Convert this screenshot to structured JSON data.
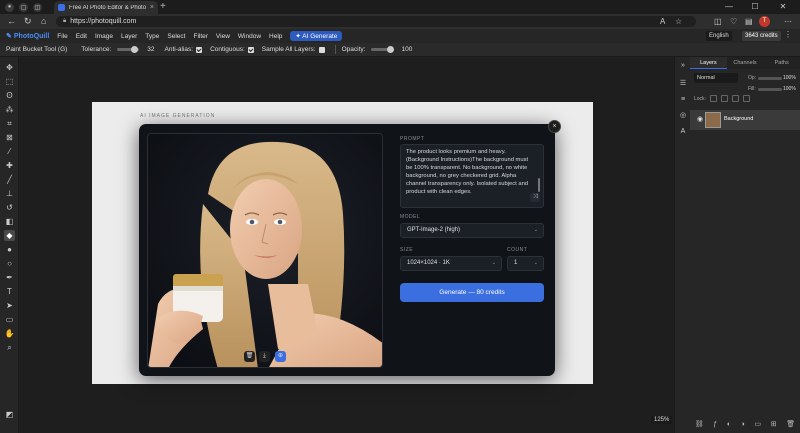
{
  "browser": {
    "tab_title": "Free AI Photo Editor & Photosho",
    "url": "https://photoquill.com",
    "new_tab": "+",
    "minimize": "—",
    "maximize": "☐",
    "close": "✕"
  },
  "menubar": {
    "logo": "PhotoQuill",
    "items": [
      "File",
      "Edit",
      "Image",
      "Layer",
      "Type",
      "Select",
      "Filter",
      "View",
      "Window",
      "Help"
    ],
    "ai_generate": "✦ AI Generate",
    "language": "English",
    "credits": "3643 credits"
  },
  "options": {
    "tool_name": "Paint Bucket Tool (G)",
    "tolerance_label": "Tolerance:",
    "tolerance_value": "32",
    "antialias_label": "Anti-alias:",
    "contiguous_label": "Contiguous:",
    "sample_all_label": "Sample All Layers:",
    "opacity_label": "Opacity:",
    "opacity_value": "100"
  },
  "canvas": {
    "doc_label": "AI IMAGE GENERATION",
    "zoom": "125%"
  },
  "modal": {
    "prompt_label": "PROMPT",
    "prompt_text": "The product looks premium and heavy. (Background Instructions)The background must be 100% transparent. No background, no white background, no grey checkered grid. Alpha channel transparency only. Isolated subject and product with clean edges.",
    "model_label": "MODEL",
    "model_value": "GPT-Image-2 (high)",
    "size_label": "SIZE",
    "size_value": "1024×1024 · 1K",
    "count_label": "COUNT",
    "count_value": "1",
    "generate_label": "Generate — 80 credits",
    "close": "×"
  },
  "layers_panel": {
    "tabs": [
      "Layers",
      "Channels",
      "Paths"
    ],
    "blend_mode": "Normal",
    "opacity_label": "Op:",
    "opacity_value": "100%",
    "fill_label": "Fill:",
    "fill_value": "100%",
    "lock_label": "Lock:",
    "layer_name": "Background"
  }
}
